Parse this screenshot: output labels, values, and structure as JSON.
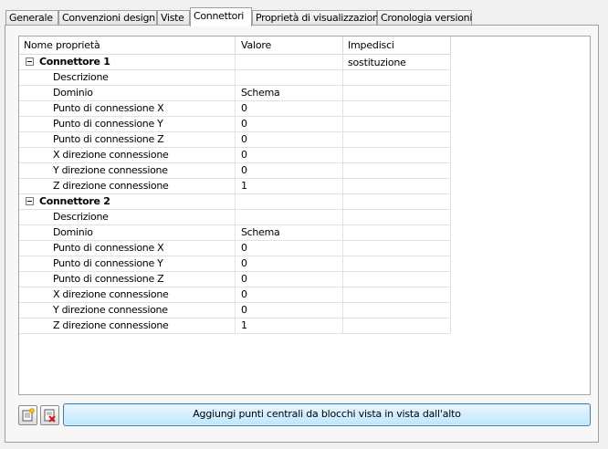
{
  "tabs": [
    {
      "label": "Generale"
    },
    {
      "label": "Convenzioni design"
    },
    {
      "label": "Viste"
    },
    {
      "label": "Connettori"
    },
    {
      "label": "Proprietà di visualizzazione"
    },
    {
      "label": "Cronologia versioni"
    }
  ],
  "active_tab": "Connettori",
  "table": {
    "headers": [
      "Nome proprietà",
      "Valore",
      "Impedisci sostituzione"
    ],
    "groups": [
      {
        "name": "Connettore 1",
        "rows": [
          {
            "name": "Descrizione",
            "value": ""
          },
          {
            "name": "Dominio",
            "value": "Schema"
          },
          {
            "name": "Punto di connessione X",
            "value": "0"
          },
          {
            "name": "Punto di connessione Y",
            "value": "0"
          },
          {
            "name": "Punto di connessione Z",
            "value": "0"
          },
          {
            "name": "X direzione connessione",
            "value": "0"
          },
          {
            "name": "Y direzione connessione",
            "value": "0"
          },
          {
            "name": "Z direzione connessione",
            "value": "1"
          }
        ]
      },
      {
        "name": "Connettore 2",
        "rows": [
          {
            "name": "Descrizione",
            "value": ""
          },
          {
            "name": "Dominio",
            "value": "Schema"
          },
          {
            "name": "Punto di connessione X",
            "value": "0"
          },
          {
            "name": "Punto di connessione Y",
            "value": "0"
          },
          {
            "name": "Punto di connessione Z",
            "value": "0"
          },
          {
            "name": "X direzione connessione",
            "value": "0"
          },
          {
            "name": "Y direzione connessione",
            "value": "0"
          },
          {
            "name": "Z direzione connessione",
            "value": "1"
          }
        ]
      }
    ]
  },
  "buttons": {
    "add_connector_icon": "add-connector-icon",
    "delete_connector_icon": "delete-connector-icon",
    "add_centers_label": "Aggiungi punti centrali da blocchi vista in vista dall'alto"
  }
}
